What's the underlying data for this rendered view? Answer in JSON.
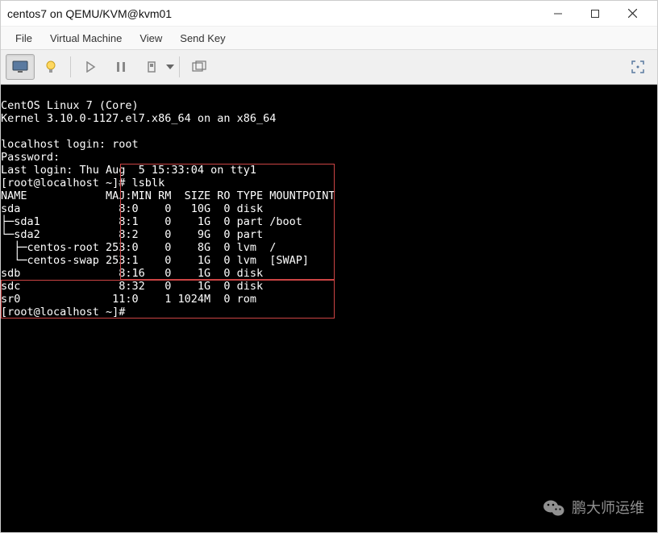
{
  "window": {
    "title": "centos7 on QEMU/KVM@kvm01"
  },
  "menu": {
    "file": "File",
    "vm": "Virtual Machine",
    "view": "View",
    "sendkey": "Send Key"
  },
  "terminal": {
    "os_line": "CentOS Linux 7 (Core)",
    "kernel_line": "Kernel 3.10.0-1127.el7.x86_64 on an x86_64",
    "login_prompt": "localhost login: root",
    "password_prompt": "Password:",
    "last_login": "Last login: Thu Aug  5 15:33:04 on tty1",
    "prompt1": "[root@localhost ~]# lsblk",
    "header": "NAME            MAJ:MIN RM  SIZE RO TYPE MOUNTPOINT",
    "rows": [
      "sda               8:0    0   10G  0 disk ",
      "├─sda1            8:1    0    1G  0 part /boot",
      "└─sda2            8:2    0    9G  0 part ",
      "  ├─centos-root 253:0    0    8G  0 lvm  /",
      "  └─centos-swap 253:1    0    1G  0 lvm  [SWAP]",
      "sdb               8:16   0    1G  0 disk ",
      "sdc               8:32   0    1G  0 disk ",
      "sr0              11:0    1 1024M  0 rom  "
    ],
    "prompt2": "[root@localhost ~]# "
  },
  "chart_data": {
    "type": "table",
    "title": "lsblk output",
    "columns": [
      "NAME",
      "MAJ:MIN",
      "RM",
      "SIZE",
      "RO",
      "TYPE",
      "MOUNTPOINT"
    ],
    "rows": [
      {
        "NAME": "sda",
        "MAJ:MIN": "8:0",
        "RM": 0,
        "SIZE": "10G",
        "RO": 0,
        "TYPE": "disk",
        "MOUNTPOINT": ""
      },
      {
        "NAME": "sda1",
        "MAJ:MIN": "8:1",
        "RM": 0,
        "SIZE": "1G",
        "RO": 0,
        "TYPE": "part",
        "MOUNTPOINT": "/boot"
      },
      {
        "NAME": "sda2",
        "MAJ:MIN": "8:2",
        "RM": 0,
        "SIZE": "9G",
        "RO": 0,
        "TYPE": "part",
        "MOUNTPOINT": ""
      },
      {
        "NAME": "centos-root",
        "MAJ:MIN": "253:0",
        "RM": 0,
        "SIZE": "8G",
        "RO": 0,
        "TYPE": "lvm",
        "MOUNTPOINT": "/"
      },
      {
        "NAME": "centos-swap",
        "MAJ:MIN": "253:1",
        "RM": 0,
        "SIZE": "1G",
        "RO": 0,
        "TYPE": "lvm",
        "MOUNTPOINT": "[SWAP]"
      },
      {
        "NAME": "sdb",
        "MAJ:MIN": "8:16",
        "RM": 0,
        "SIZE": "1G",
        "RO": 0,
        "TYPE": "disk",
        "MOUNTPOINT": ""
      },
      {
        "NAME": "sdc",
        "MAJ:MIN": "8:32",
        "RM": 0,
        "SIZE": "1G",
        "RO": 0,
        "TYPE": "disk",
        "MOUNTPOINT": ""
      },
      {
        "NAME": "sr0",
        "MAJ:MIN": "11:0",
        "RM": 1,
        "SIZE": "1024M",
        "RO": 0,
        "TYPE": "rom",
        "MOUNTPOINT": ""
      }
    ]
  },
  "watermark": {
    "text": "鹏大师运维"
  }
}
